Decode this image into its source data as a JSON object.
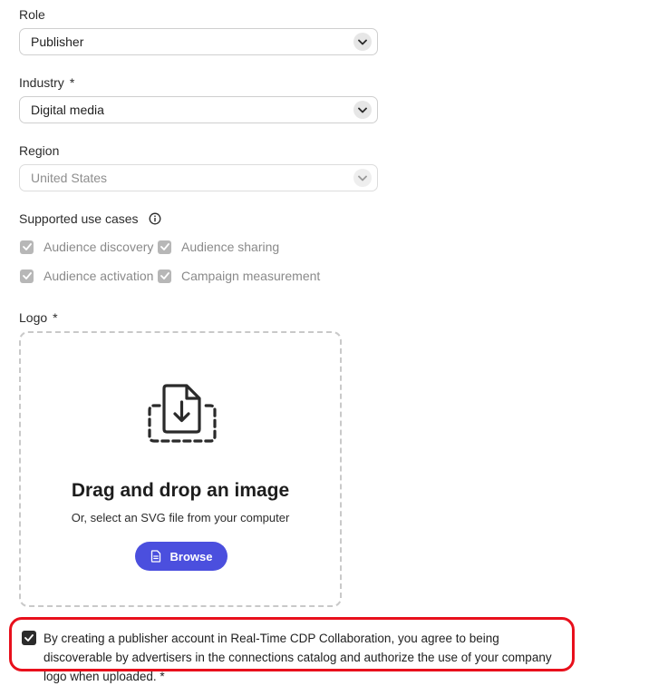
{
  "role": {
    "label": "Role",
    "value": "Publisher"
  },
  "industry": {
    "label": "Industry",
    "required_mark": "*",
    "value": "Digital media"
  },
  "region": {
    "label": "Region",
    "value": "United States"
  },
  "use_cases": {
    "label": "Supported use cases",
    "items": [
      {
        "label": "Audience discovery",
        "checked": true
      },
      {
        "label": "Audience sharing",
        "checked": true
      },
      {
        "label": "Audience activation",
        "checked": true
      },
      {
        "label": "Campaign measurement",
        "checked": true
      }
    ]
  },
  "logo": {
    "label": "Logo",
    "required_mark": "*",
    "drop_title": "Drag and drop an image",
    "drop_subtitle": "Or, select an SVG file from your computer",
    "browse_label": "Browse"
  },
  "consent": {
    "checked": true,
    "text": "By creating a publisher account in Real-Time CDP Collaboration, you agree to being discoverable by advertisers in the connections catalog and authorize the use of your company logo when uploaded. *"
  },
  "colors": {
    "accent": "#4b4fde",
    "highlight": "#e8101c"
  }
}
